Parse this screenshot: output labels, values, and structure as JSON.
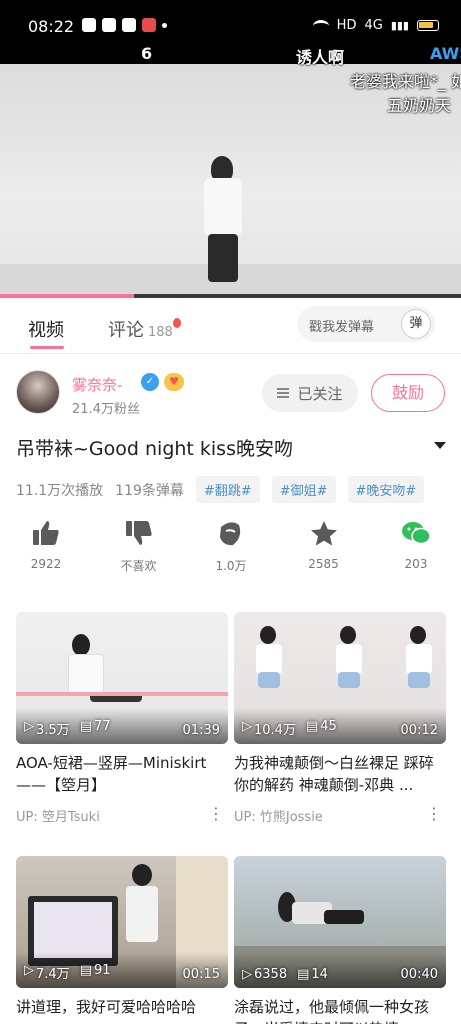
{
  "status_bar": {
    "time": "08:22",
    "network": "HD",
    "signal": "4G"
  },
  "player": {
    "danmaku": [
      {
        "text": "6"
      },
      {
        "text": "诱人啊"
      },
      {
        "text": "AWS"
      },
      {
        "text": "老婆我来啦*_ 如"
      },
      {
        "text": "五奶奶天"
      }
    ],
    "progress_fraction": 0.29
  },
  "tabs": {
    "video_label": "视频",
    "comments_label": "评论",
    "comments_count": "188",
    "danmaku_placeholder": "戳我发弹幕",
    "danmaku_toggle_label": "弹"
  },
  "uploader": {
    "name": "雾奈奈-",
    "fans": "21.4万粉丝",
    "follow_label": "已关注",
    "charge_label": "鼓励"
  },
  "video": {
    "title": "吊带袜~Good night kiss晚安吻",
    "plays": "11.1万次播放",
    "danmaku_count": "119条弹幕",
    "tags": [
      "#翻跳#",
      "#御姐#",
      "#晚安吻#"
    ]
  },
  "actions": [
    {
      "icon": "thumbs-up-icon",
      "label": "2922"
    },
    {
      "icon": "thumbs-down-icon",
      "label": "不喜欢"
    },
    {
      "icon": "coin-icon",
      "label": "1.0万"
    },
    {
      "icon": "star-icon",
      "label": "2585"
    },
    {
      "icon": "wechat-share-icon",
      "label": "203"
    }
  ],
  "recommendations": [
    {
      "plays": "3.5万",
      "comments": "77",
      "duration": "01:39",
      "title": "AOA-短裙—竖屏—Miniskirt——【箜月】",
      "up": "UP: 箜月Tsuki"
    },
    {
      "plays": "10.4万",
      "comments": "45",
      "duration": "00:12",
      "title": "为我神魂颠倒〜白丝裸足 踩碎你的解药 神魂颠倒-邓典 ...",
      "up": "UP: 竹熊Jossie"
    },
    {
      "plays": "7.4万",
      "comments": "91",
      "duration": "00:15",
      "title": "讲道理，我好可爱哈哈哈哈",
      "up": ""
    },
    {
      "plays": "6358",
      "comments": "14",
      "duration": "00:40",
      "title": "涂磊说过，他最倾佩一种女孩子，当受情来时可以热情",
      "up": ""
    }
  ],
  "colors": {
    "accent": "#fb7299",
    "tag_text": "#4a90c8",
    "share_green": "#2fbf5b"
  }
}
